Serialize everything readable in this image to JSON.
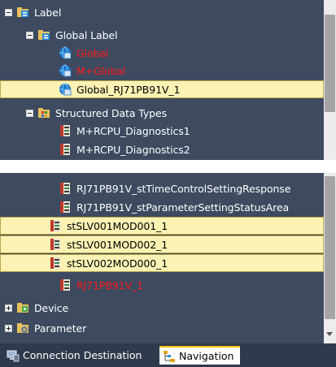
{
  "tree_top": {
    "items": [
      {
        "label": "Label",
        "icon": "label-folder-icon",
        "expander": "minus"
      },
      {
        "label": "Global Label",
        "icon": "label-folder-icon",
        "expander": "minus"
      },
      {
        "label": "Global",
        "icon": "global-label-icon",
        "state": "error"
      },
      {
        "label": "M+Global",
        "icon": "global-label-icon",
        "state": "error"
      },
      {
        "label": "Global_RJ71PB91V_1",
        "icon": "global-label-icon",
        "state": "selected"
      },
      {
        "label": "Structured Data Types",
        "icon": "structured-data-folder-icon",
        "expander": "minus"
      },
      {
        "label": "M+RCPU_Diagnostics1",
        "icon": "structured-data-icon"
      },
      {
        "label": "M+RCPU_Diagnostics2",
        "icon": "structured-data-icon"
      }
    ]
  },
  "tree_bottom": {
    "items": [
      {
        "label": "RJ71PB91V_stTimeControlSettingResponse",
        "icon": "structured-data-icon"
      },
      {
        "label": "RJ71PB91V_stParameterSettingStatusArea",
        "icon": "structured-data-icon"
      },
      {
        "label": "stSLV001MOD001_1",
        "icon": "structured-data-icon",
        "state": "selected"
      },
      {
        "label": "stSLV001MOD002_1",
        "icon": "structured-data-icon",
        "state": "selected"
      },
      {
        "label": "stSLV002MOD000_1",
        "icon": "structured-data-icon",
        "state": "selected"
      },
      {
        "label": "RJ71PB91V_1",
        "icon": "structured-data-icon",
        "state": "error"
      },
      {
        "label": "Device",
        "icon": "device-icon",
        "expander": "plus"
      },
      {
        "label": "Parameter",
        "icon": "parameter-icon",
        "expander": "plus"
      }
    ]
  },
  "tabs": {
    "connection_label": "Connection Destination",
    "navigation_label": "Navigation",
    "active": "Navigation"
  },
  "colors": {
    "tree_background": "#3d4a5f",
    "selected_background": "#fbf2b4",
    "error_text": "#ff1a1a",
    "active_tab_accent": "#f5c400"
  }
}
